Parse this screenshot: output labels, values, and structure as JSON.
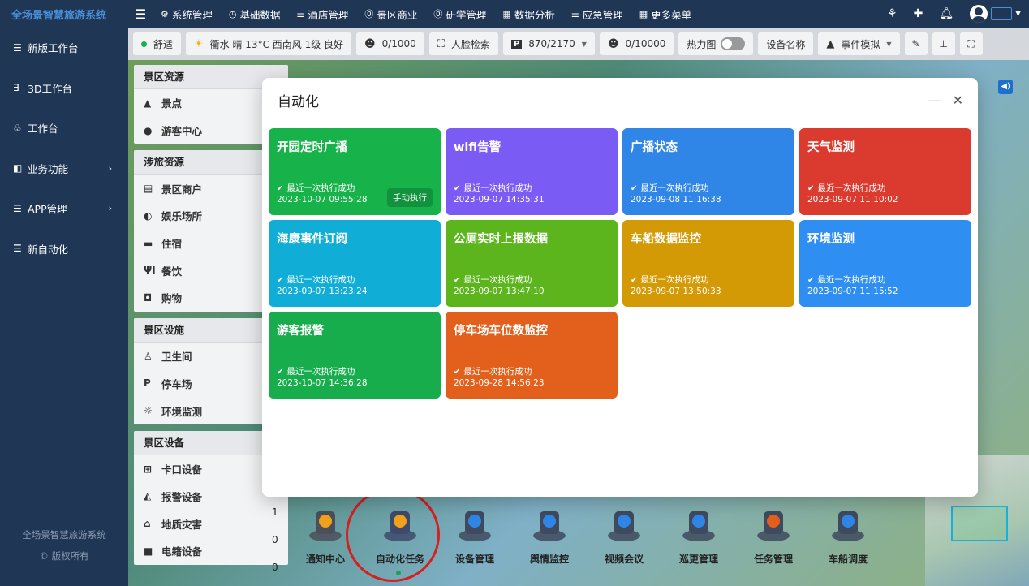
{
  "brand": "全场景智慧旅游系统",
  "nav": [
    {
      "icon": "⚙",
      "label": "系统管理",
      "name": "gear-icon"
    },
    {
      "icon": "◷",
      "label": "基础数据",
      "name": "clock-icon"
    },
    {
      "icon": "☰",
      "label": "酒店管理",
      "name": "list-icon"
    },
    {
      "icon": "⓪",
      "label": "景区商业",
      "name": "coin-icon"
    },
    {
      "icon": "⓪",
      "label": "研学管理",
      "name": "coin-icon"
    },
    {
      "icon": "▦",
      "label": "数据分析",
      "name": "chart-icon"
    },
    {
      "icon": "☰",
      "label": "应急管理",
      "name": "list-icon"
    },
    {
      "icon": "▦",
      "label": "更多菜单",
      "name": "grid-icon"
    }
  ],
  "sidebar": [
    {
      "icon": "☰",
      "label": "新版工作台",
      "arrow": ""
    },
    {
      "icon": "∃",
      "label": "3D工作台",
      "arrow": ""
    },
    {
      "icon": "♧",
      "label": "工作台",
      "arrow": ""
    },
    {
      "icon": "◧",
      "label": "业务功能",
      "arrow": "›"
    },
    {
      "icon": "☰",
      "label": "APP管理",
      "arrow": "›"
    },
    {
      "icon": "☰",
      "label": "新自动化",
      "arrow": ""
    }
  ],
  "footer": {
    "line1": "全场景智慧旅游系统",
    "line2": "© 版权所有"
  },
  "toolbar": {
    "status": "舒适",
    "weather": "衢水  晴  13°C  西南风  1级  良好",
    "visitors": "0/1000",
    "face_search": "人脸检索",
    "parking": "870/2170",
    "visitors2": "0/10000",
    "heatmap": "热力图",
    "device_name": "设备名称",
    "event_sim": "事件模拟"
  },
  "resources": [
    {
      "head": "景区资源",
      "rows": [
        {
          "icon": "▲",
          "label": "景点"
        },
        {
          "icon": "●",
          "label": "游客中心"
        }
      ]
    },
    {
      "head": "涉旅资源",
      "rows": [
        {
          "icon": "▤",
          "label": "景区商户"
        },
        {
          "icon": "◐",
          "label": "娱乐场所"
        },
        {
          "icon": "▬",
          "label": "住宿"
        },
        {
          "icon": "ΨΙ",
          "label": "餐饮"
        },
        {
          "icon": "◘",
          "label": "购物"
        }
      ]
    },
    {
      "head": "景区设施",
      "rows": [
        {
          "icon": "♙",
          "label": "卫生间"
        },
        {
          "icon": "P",
          "label": "停车场"
        },
        {
          "icon": "☼",
          "label": "环境监测"
        }
      ]
    },
    {
      "head": "景区设备",
      "rows": [
        {
          "icon": "⊞",
          "label": "卡口设备"
        },
        {
          "icon": "◭",
          "label": "报警设备"
        },
        {
          "icon": "⌂",
          "label": "地质灾害"
        },
        {
          "icon": "■",
          "label": "电籍设备"
        }
      ]
    }
  ],
  "res_counts": [
    "1",
    "0",
    "0"
  ],
  "modal": {
    "title": "自动化",
    "cards": [
      {
        "title": "开园定时广播",
        "status": "最近一次执行成功",
        "time": "2023-10-07 09:55:28",
        "color": "#17b24a",
        "button": "手动执行"
      },
      {
        "title": "wifi告警",
        "status": "最近一次执行成功",
        "time": "2023-09-07 14:35:31",
        "color": "#7a5cf5",
        "button": ""
      },
      {
        "title": "广播状态",
        "status": "最近一次执行成功",
        "time": "2023-09-08 11:16:38",
        "color": "#2f86e6",
        "button": ""
      },
      {
        "title": "天气监测",
        "status": "最近一次执行成功",
        "time": "2023-09-07 11:10:02",
        "color": "#db3a2f",
        "button": ""
      },
      {
        "title": "海康事件订阅",
        "status": "最近一次执行成功",
        "time": "2023-09-07 13:23:24",
        "color": "#10aed6",
        "button": ""
      },
      {
        "title": "公厕实时上报数据",
        "status": "最近一次执行成功",
        "time": "2023-09-07 13:47:10",
        "color": "#5cb51c",
        "button": ""
      },
      {
        "title": "车船数据监控",
        "status": "最近一次执行成功",
        "time": "2023-09-07 13:50:33",
        "color": "#d49a06",
        "button": ""
      },
      {
        "title": "环境监测",
        "status": "最近一次执行成功",
        "time": "2023-09-07 11:15:52",
        "color": "#2e8ef2",
        "button": ""
      },
      {
        "title": "游客报警",
        "status": "最近一次执行成功",
        "time": "2023-10-07 14:36:28",
        "color": "#17ad4c",
        "button": ""
      },
      {
        "title": "停车场车位数监控",
        "status": "最近一次执行成功",
        "time": "2023-09-28 14:56:23",
        "color": "#e2601c",
        "button": ""
      }
    ]
  },
  "dock": [
    {
      "label": "通知中心",
      "icon": "bell-icon",
      "c1": "#4b4f5c",
      "c2": "#f0a21c"
    },
    {
      "label": "自动化任务",
      "icon": "automation-icon",
      "c1": "#3d4a6b",
      "c2": "#f0a21c"
    },
    {
      "label": "设备管理",
      "icon": "device-icon",
      "c1": "#3f4a5e",
      "c2": "#2f86e6"
    },
    {
      "label": "舆情监控",
      "icon": "globe-icon",
      "c1": "#3f4a5e",
      "c2": "#2f86e6"
    },
    {
      "label": "视频会议",
      "icon": "camera-icon",
      "c1": "#3f4a5e",
      "c2": "#2f86e6"
    },
    {
      "label": "巡更管理",
      "icon": "shield-icon",
      "c1": "#3f4a5e",
      "c2": "#2f86e6"
    },
    {
      "label": "任务管理",
      "icon": "cabinet-icon",
      "c1": "#3f4a5e",
      "c2": "#e2601c"
    },
    {
      "label": "车船调度",
      "icon": "boat-icon",
      "c1": "#3f4a5e",
      "c2": "#2f86e6"
    }
  ],
  "active_dock": 1
}
